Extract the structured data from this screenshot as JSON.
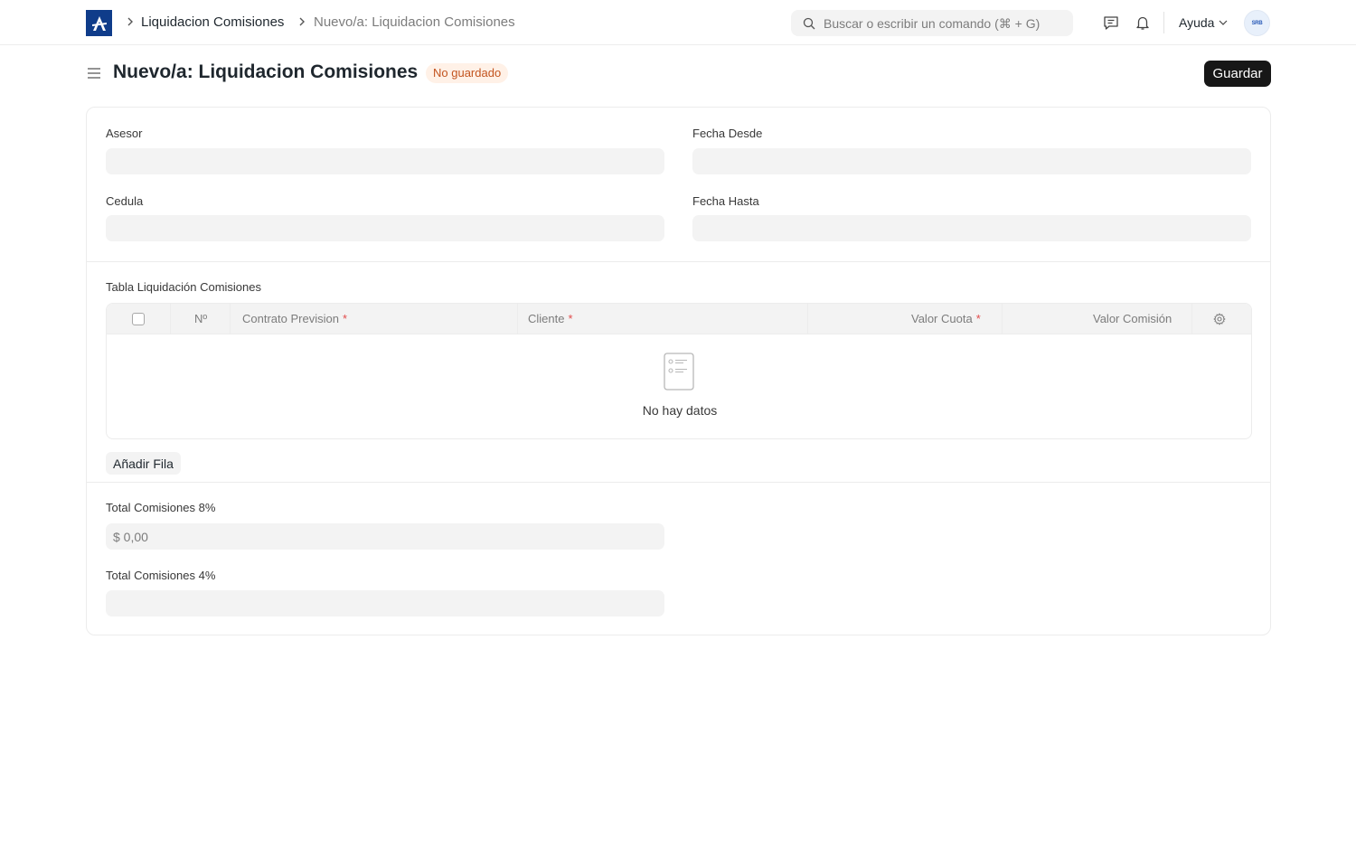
{
  "navbar": {
    "breadcrumbs": [
      "Liquidacion Comisiones",
      "Nuevo/a: Liquidacion Comisiones"
    ],
    "search_placeholder": "Buscar o escribir un comando (⌘ + G)",
    "help_label": "Ayuda",
    "avatar_initials": "SRB"
  },
  "page": {
    "title": "Nuevo/a: Liquidacion Comisiones",
    "status": "No guardado",
    "save_label": "Guardar"
  },
  "form": {
    "asesor_label": "Asesor",
    "fecha_desde_label": "Fecha Desde",
    "cedula_label": "Cedula",
    "fecha_hasta_label": "Fecha Hasta",
    "table_label": "Tabla Liquidación Comisiones",
    "total_8_label": "Total Comisiones 8%",
    "total_8_value": "$ 0,00",
    "total_4_label": "Total Comisiones 4%"
  },
  "grid": {
    "columns": [
      {
        "label": "Nº",
        "required": false
      },
      {
        "label": "Contrato Prevision",
        "required": true
      },
      {
        "label": "Cliente",
        "required": true
      },
      {
        "label": "Valor Cuota",
        "required": true
      },
      {
        "label": "Valor Comisión",
        "required": false
      }
    ],
    "required_mark": "*",
    "empty_text": "No hay datos",
    "add_row_label": "Añadir Fila"
  },
  "colors": {
    "brand": "#0f3c8a",
    "primary_button": "#171717",
    "status_bg": "#fff1e7",
    "status_text": "#c3541f",
    "input_bg": "#f3f3f3"
  }
}
